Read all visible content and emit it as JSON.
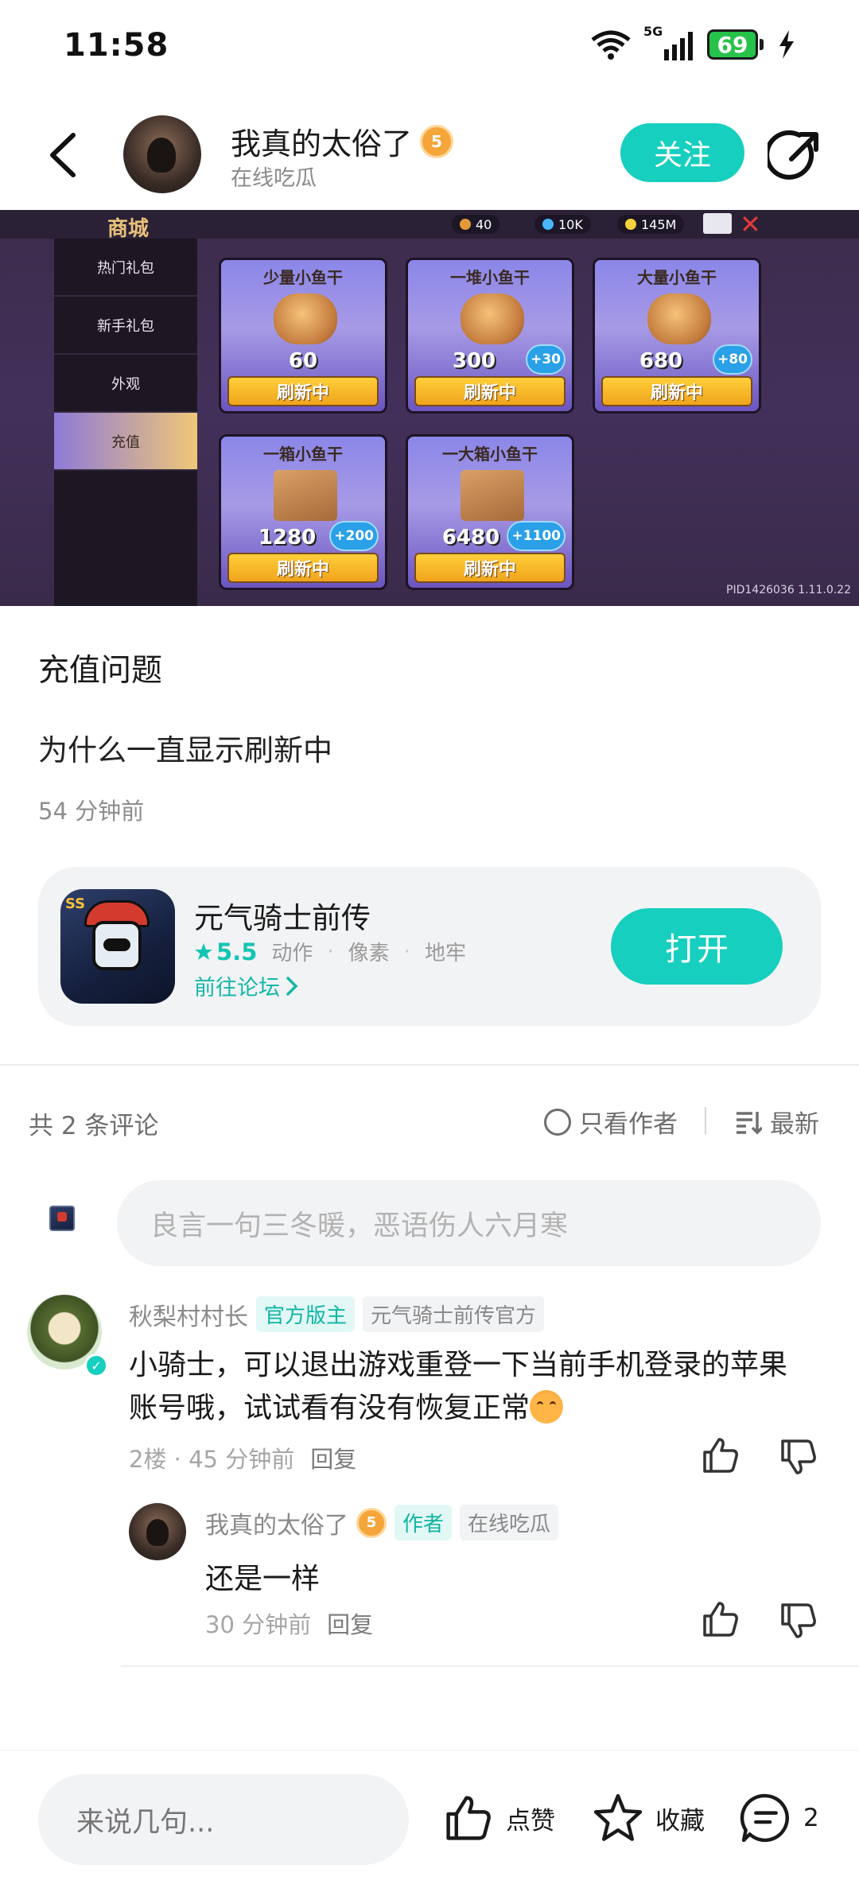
{
  "status_bar": {
    "time": "11:58",
    "network": "5G",
    "battery": "69"
  },
  "header": {
    "username": "我真的太俗了",
    "level": "5",
    "subtitle": "在线吃瓜",
    "follow_label": "关注"
  },
  "banner": {
    "shop_title": "商城",
    "currencies": [
      "40",
      "10K",
      "145M"
    ],
    "tabs": [
      "热门礼包",
      "新手礼包",
      "外观",
      "充值"
    ],
    "active_tab": "充值",
    "items": [
      {
        "name": "少量小鱼干",
        "amount": "60",
        "bonus": "",
        "button": "刷新中"
      },
      {
        "name": "一堆小鱼干",
        "amount": "300",
        "bonus": "+30",
        "button": "刷新中"
      },
      {
        "name": "大量小鱼干",
        "amount": "680",
        "bonus": "+80",
        "button": "刷新中"
      },
      {
        "name": "一箱小鱼干",
        "amount": "1280",
        "bonus": "+200",
        "button": "刷新中"
      },
      {
        "name": "一大箱小鱼干",
        "amount": "6480",
        "bonus": "+1100",
        "button": "刷新中"
      }
    ],
    "pid": "PID1426036 1.11.0.22"
  },
  "post": {
    "title": "充值问题",
    "body": "为什么一直显示刷新中",
    "time": "54 分钟前"
  },
  "game": {
    "name": "元气骑士前传",
    "rating": "5.5",
    "tags": [
      "动作",
      "像素",
      "地牢"
    ],
    "forum_link": "前往论坛",
    "open_label": "打开"
  },
  "comments_header": {
    "count": "共 2 条评论",
    "author_only": "只看作者",
    "sort": "最新"
  },
  "comment_input": {
    "placeholder": "良言一句三冬暖，恶语伤人六月寒"
  },
  "comment1": {
    "name": "秋梨村村长",
    "tag_official": "官方版主",
    "tag_org": "元气骑士前传官方",
    "text": "小骑士，可以退出游戏重登一下当前手机登录的苹果账号哦，试试看有没有恢复正常",
    "floor_time": "2楼 · 45 分钟前",
    "reply": "回复"
  },
  "reply1": {
    "name": "我真的太俗了",
    "level": "5",
    "tag_author": "作者",
    "tag_status": "在线吃瓜",
    "text": "还是一样",
    "time": "30 分钟前",
    "reply": "回复"
  },
  "bottom_bar": {
    "input_placeholder": "来说几句...",
    "like_label": "点赞",
    "fav_label": "收藏",
    "comment_count": "2"
  }
}
